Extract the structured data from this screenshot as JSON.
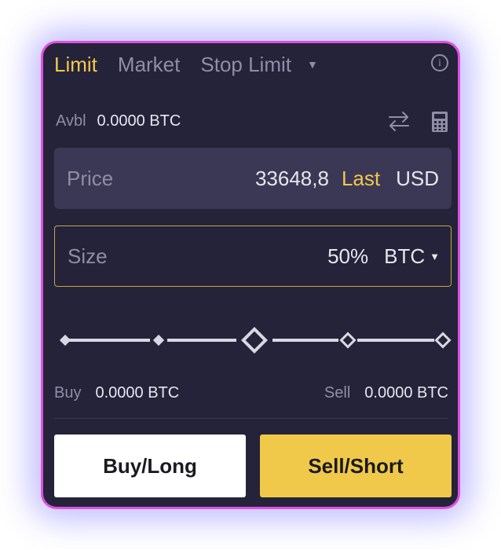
{
  "tabs": [
    {
      "label": "Limit",
      "active": true
    },
    {
      "label": "Market",
      "active": false
    },
    {
      "label": "Stop Limit",
      "active": false
    }
  ],
  "icons": {
    "tab_more": "chevron-down-icon",
    "info": "info-icon",
    "swap": "swap-arrows-icon",
    "calculator": "calculator-icon"
  },
  "available": {
    "label": "Avbl",
    "value": "0.0000 BTC"
  },
  "price": {
    "label": "Price",
    "value": "33648,8",
    "last_label": "Last",
    "unit": "USD"
  },
  "size": {
    "label": "Size",
    "value": "50%",
    "unit": "BTC"
  },
  "slider": {
    "percent": 50,
    "marks": [
      0,
      25,
      50,
      75,
      100
    ]
  },
  "balances": {
    "buy_label": "Buy",
    "buy_value": "0.0000 BTC",
    "sell_label": "Sell",
    "sell_value": "0.0000 BTC"
  },
  "buttons": {
    "buy": "Buy/Long",
    "sell": "Sell/Short"
  },
  "colors": {
    "accent": "#f3c84b",
    "panel_bg": "#24233a",
    "field_bg": "#3a3855",
    "border_glow": "#e04fe0",
    "sell_button": "#f0c94a",
    "buy_button": "#ffffff"
  }
}
